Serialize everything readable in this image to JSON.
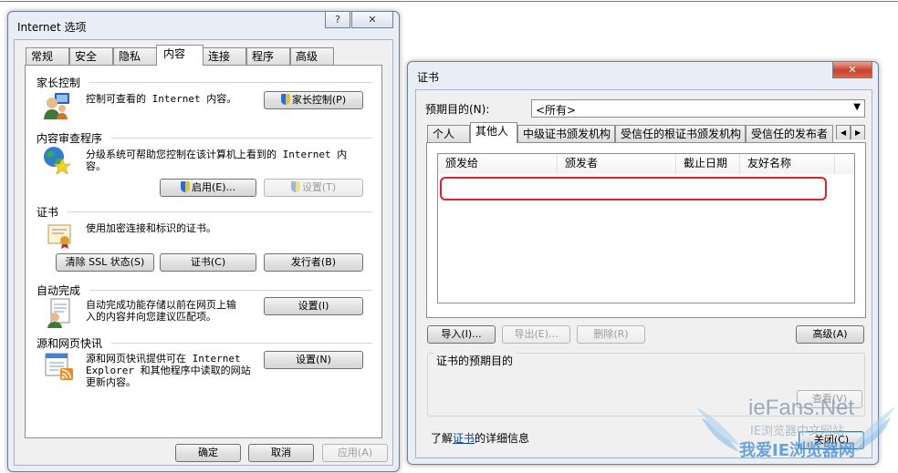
{
  "internet_options": {
    "title": "Internet 选项",
    "help_label": "?",
    "close_label": "✕",
    "tabs": [
      "常规",
      "安全",
      "隐私",
      "内容",
      "连接",
      "程序",
      "高级"
    ],
    "active_tab": "内容",
    "parental": {
      "heading": "家长控制",
      "desc": "控制可查看的 Internet 内容。",
      "button": "家长控制(P)"
    },
    "advisor": {
      "heading": "内容审查程序",
      "desc_line1": "分级系统可帮助您控制在该计算机上看到的 Internet 内",
      "desc_line2": "容。",
      "enable_button": "启用(E)...",
      "settings_button": "设置(T)"
    },
    "certs": {
      "heading": "证书",
      "desc": "使用加密连接和标识的证书。",
      "clear_ssl_button": "清除 SSL 状态(S)",
      "certs_button": "证书(C)",
      "publishers_button": "发行者(B)"
    },
    "autocomplete": {
      "heading": "自动完成",
      "desc_line1": "自动完成功能存储以前在网页上输",
      "desc_line2": "入的内容并向您建议匹配项。",
      "settings_button": "设置(I)"
    },
    "feeds": {
      "heading": "源和网页快讯",
      "desc_line1": "源和网页快讯提供可在 Internet",
      "desc_line2": "Explorer 和其他程序中读取的网站",
      "desc_line3": "更新内容。",
      "settings_button": "设置(N)"
    },
    "ok_button": "确定",
    "cancel_button": "取消",
    "apply_button": "应用(A)"
  },
  "certificates": {
    "title": "证书",
    "close_label": "✕",
    "purpose_label": "预期目的(N):",
    "purpose_value": "<所有>",
    "tabs": [
      "个人",
      "其他人",
      "中级证书颁发机构",
      "受信任的根证书颁发机构",
      "受信任的发布者"
    ],
    "active_tab": "其他人",
    "columns": [
      "颁发给",
      "颁发者",
      "截止日期",
      "友好名称"
    ],
    "import_button": "导入(I)...",
    "export_button": "导出(E)...",
    "remove_button": "删除(R)",
    "advanced_button": "高级(A)",
    "purposes_heading": "证书的预期目的",
    "view_button": "查看(V)",
    "learn_prefix": "了解",
    "learn_link": "证书",
    "learn_suffix": "的详细信息",
    "close_button": "关闭(C)",
    "highlight_color": "#e0202a"
  },
  "watermark": {
    "brand": "ieFans.Net",
    "line1": "IE浏览器中文网站",
    "line2": "我爱IE浏览器网"
  }
}
